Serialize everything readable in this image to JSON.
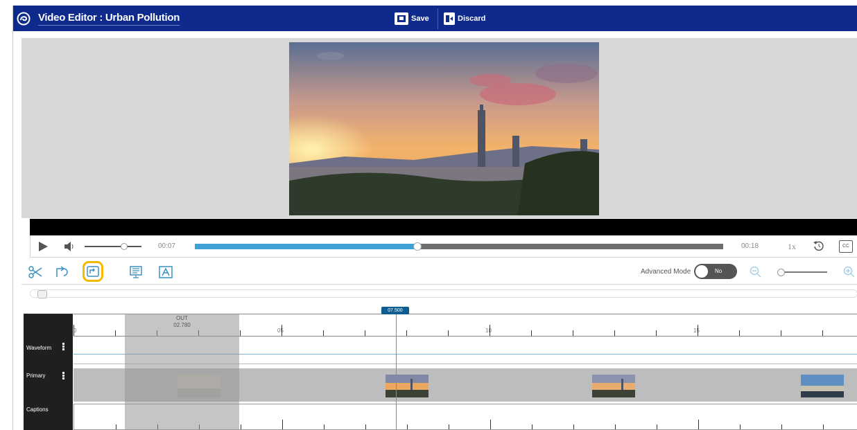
{
  "header": {
    "title": "Video Editor : Urban Pollution",
    "save_label": "Save",
    "discard_label": "Discard"
  },
  "transport": {
    "current_time": "00:07",
    "duration": "00:18",
    "speed": "1x",
    "cc_label": "CC",
    "progress": 0.42
  },
  "tools": {
    "advanced_mode_label": "Advanced Mode",
    "toggle_state": "No"
  },
  "timeline": {
    "playhead_time": "07.500",
    "cut_label": "OUT",
    "cut_time": "02.780",
    "ruler_labels": [
      "0",
      "05",
      "10",
      "15"
    ],
    "tracks": {
      "waveform": "Waveform",
      "primary": "Primary",
      "captions": "Captions"
    }
  },
  "colors": {
    "header_bg": "#0d2a8c",
    "accent_blue": "#3ea1d6",
    "selected_tool": "#f3b900"
  }
}
